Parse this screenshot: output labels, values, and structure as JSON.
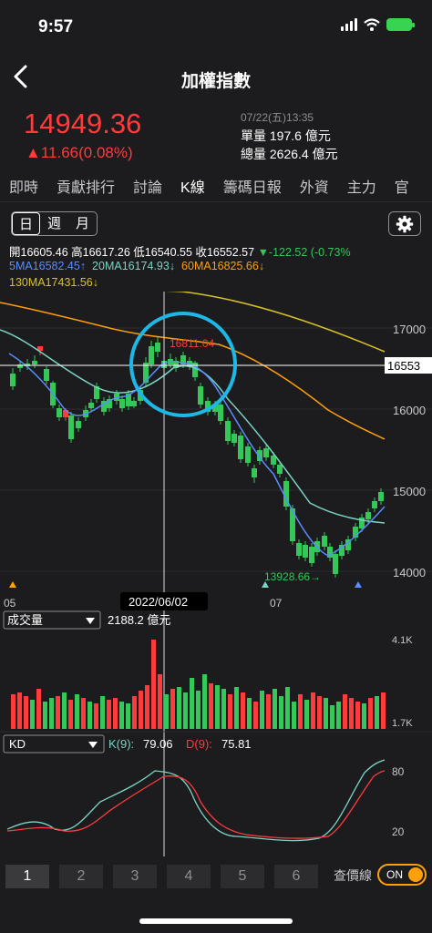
{
  "status": {
    "time": "9:57"
  },
  "nav": {
    "title": "加權指數"
  },
  "quote": {
    "price": "14949.36",
    "change": "▲11.66(0.08%)",
    "date": "07/22(五)13:35",
    "unit_volume": "單量 197.6 億元",
    "total_volume": "總量 2626.4 億元"
  },
  "tabs": [
    "即時",
    "貢獻排行",
    "討論",
    "K線",
    "籌碼日報",
    "外資",
    "主力",
    "官"
  ],
  "period": {
    "day": "日",
    "week": "週",
    "month": "月"
  },
  "ohlc": {
    "open_label": "開",
    "open": "16605.46",
    "high_label": "高",
    "high": "16617.26",
    "low_label": "低",
    "low": "16540.55",
    "close_label": "收",
    "close": "16552.57",
    "change": "▼-122.52 (-0.73%"
  },
  "ma": {
    "ma5": "5MA16582.45↑",
    "ma20": "20MA16174.93↓",
    "ma60": "60MA16825.66↓",
    "ma130": "130MA17431.56↓"
  },
  "price_axis": [
    "17000",
    "16000",
    "15000",
    "14000"
  ],
  "crosshair_value": "16553",
  "crosshair_date": "2022/06/02",
  "high_annotation": "16811.04",
  "low_annotation": "13928.66→",
  "month_labels": {
    "left": "05",
    "right": "07"
  },
  "volume": {
    "selector": "成交量",
    "value": "2188.2 億元",
    "axis_top": "4.1K",
    "axis_bottom": "1.7K"
  },
  "kd": {
    "selector": "KD",
    "k_label": "K(9):",
    "k_value": "79.06",
    "d_label": "D(9):",
    "d_value": "75.81",
    "axis_top": "80",
    "axis_bottom": "20"
  },
  "bottom": {
    "buttons": [
      "1",
      "2",
      "3",
      "4",
      "5",
      "6"
    ],
    "price_line": "查價線",
    "toggle": "ON"
  },
  "colors": {
    "up": "#ff3b3b",
    "down": "#34c759",
    "ma5": "#5a8cff",
    "ma20": "#7ad4c4",
    "ma60": "#ff9f0a",
    "ma130": "#d6c12a",
    "annotation": "#1eb8e6"
  }
}
